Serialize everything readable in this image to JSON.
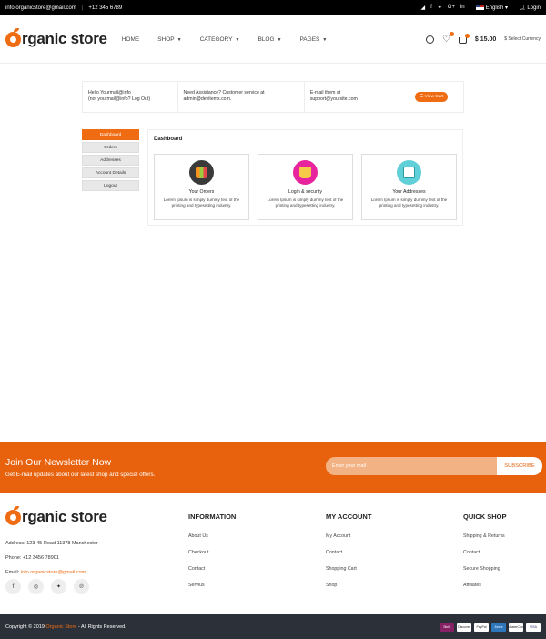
{
  "topbar": {
    "email": "info.organicstore@gmail.com",
    "separator": "|",
    "phone": "+12 345 6789",
    "social_icons": [
      "rss-icon",
      "facebook-icon",
      "twitter-icon",
      "google-plus-icon",
      "linkedin-icon"
    ],
    "social_glyphs": [
      "◢",
      "f",
      "✦",
      "G+",
      "in"
    ],
    "language": "English",
    "login": "Login"
  },
  "header": {
    "logo_text": "rganic store",
    "nav": [
      {
        "label": "HOME"
      },
      {
        "label": "SHOP"
      },
      {
        "label": "CATEGORY"
      },
      {
        "label": "BLOG"
      },
      {
        "label": "PAGES"
      }
    ],
    "price": "$ 15.00",
    "currency_label": "$ Select Currency"
  },
  "info": {
    "hello_line1": "Hello Yourmail@info",
    "hello_line2": "(not yourmail@info? Log Out)",
    "assist_line1": "Need Assistance? Customer service at",
    "assist_line2": "admin@devitems.com.",
    "email_line1": "E-mail them at",
    "email_line2": "support@yoursite.com",
    "view_cart": "☰ View Cart"
  },
  "sidebar": {
    "items": [
      {
        "label": "Dashboard",
        "active": true
      },
      {
        "label": "Orders",
        "active": false
      },
      {
        "label": "Addresses",
        "active": false
      },
      {
        "label": "Account Details",
        "active": false
      },
      {
        "label": "Logout",
        "active": false
      }
    ]
  },
  "dashboard": {
    "title": "Dashboard",
    "cards": [
      {
        "title": "Your Orders",
        "desc": "Lorem Ipsum is simply dummy text of the printing and typesetting industry."
      },
      {
        "title": "Login & security",
        "desc": "Lorem Ipsum is simply dummy text of the printing and typesetting industry."
      },
      {
        "title": "Your Addresses",
        "desc": "Lorem Ipsum is simply dummy text of the printing and typesetting industry."
      }
    ]
  },
  "newsletter": {
    "title": "Join Our Newsletter Now",
    "subtitle": "Get E-mail updates about our latest shop and special offers.",
    "placeholder": "Enter your mail",
    "button": "SUBSCRIBE"
  },
  "footer": {
    "logo_text": "rganic store",
    "address": "Address: 123-45 Road 11378 Manchester",
    "phone": "Phone: +12 3456 78901",
    "email_label": "Email: ",
    "email_value": "info.organicstore@gmail.com",
    "socials": [
      {
        "icon": "facebook-icon",
        "glyph": "f"
      },
      {
        "icon": "instagram-icon",
        "glyph": "◎"
      },
      {
        "icon": "twitter-icon",
        "glyph": "✦"
      },
      {
        "icon": "pinterest-icon",
        "glyph": "℗"
      }
    ],
    "columns": [
      {
        "title": "INFORMATION",
        "links": [
          "About Us",
          "Checkout",
          "Contact",
          "Servius"
        ]
      },
      {
        "title": "MY ACCOUNT",
        "links": [
          "My Account",
          "Contact",
          "Shopping Cart",
          "Shop"
        ]
      },
      {
        "title": "QUICK SHOP",
        "links": [
          "Shipping & Returns",
          "Contact",
          "Secure Shopping",
          "Affiliates"
        ]
      }
    ]
  },
  "bottom": {
    "copyright_pre": "Copyright © 2019 ",
    "brand": "Organic Store",
    "copyright_post": " - All Rights Reserved.",
    "payments": [
      "Skrill",
      "Discover",
      "PayPal",
      "Amex",
      "MasterCard",
      "VISA"
    ]
  },
  "colors": {
    "accent": "#ef6c13",
    "newsletter_bg": "#e8620d",
    "bottom_bar": "#2c3039",
    "topbar": "#000000"
  }
}
